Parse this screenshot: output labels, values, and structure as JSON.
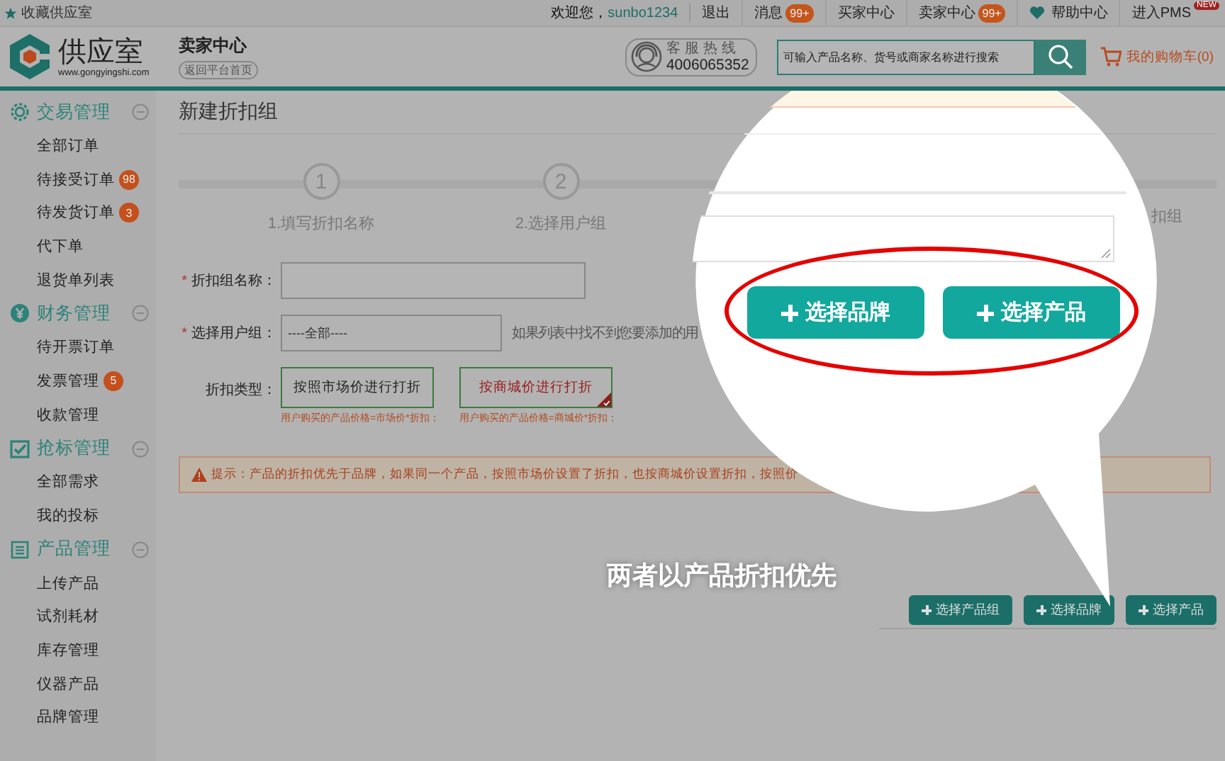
{
  "top_bar": {
    "bookmark": "收藏供应室",
    "greeting": "欢迎您，",
    "username": "sunbo1234",
    "links": [
      {
        "kind": "plain",
        "label": "退出"
      },
      {
        "kind": "badge",
        "label": "消息",
        "badge": "99+"
      },
      {
        "kind": "plain",
        "label": "买家中心"
      },
      {
        "kind": "badge",
        "label": "卖家中心",
        "badge": "99+"
      },
      {
        "kind": "help",
        "label": "帮助中心"
      },
      {
        "kind": "new",
        "label": "进入PMS",
        "tag": "NEW"
      }
    ]
  },
  "header": {
    "logo_name": "供应室",
    "logo_url": "www.gongyingshi.com",
    "title": "卖家中心",
    "back_link": "返回平台首页",
    "hotline_label": "客服热线",
    "hotline_number": "4006065352",
    "search_placeholder": "可输入产品名称、货号或商家名称进行搜索",
    "cart": "我的购物车(0)"
  },
  "sidebar": {
    "groups": [
      {
        "kind": "trade",
        "title": "交易管理",
        "expanded": true,
        "items": [
          {
            "label": "全部订单"
          },
          {
            "label": "待接受订单",
            "badge": "98"
          },
          {
            "label": "待发货订单",
            "badge": "3"
          },
          {
            "label": "代下单"
          },
          {
            "label": "退货单列表"
          }
        ]
      },
      {
        "kind": "finance",
        "title": "财务管理",
        "expanded": true,
        "items": [
          {
            "label": "待开票订单"
          },
          {
            "label": "发票管理",
            "badge": "5"
          },
          {
            "label": "收款管理"
          }
        ]
      },
      {
        "kind": "bid",
        "title": "抢标管理",
        "expanded": true,
        "items": [
          {
            "label": "全部需求"
          },
          {
            "label": "我的投标"
          }
        ]
      },
      {
        "kind": "product",
        "title": "产品管理",
        "expanded": true,
        "items": [
          {
            "label": "上传产品"
          },
          {
            "label": "试剂耗材"
          },
          {
            "label": "库存管理"
          },
          {
            "label": "仪器产品"
          },
          {
            "label": "品牌管理"
          }
        ]
      }
    ]
  },
  "main": {
    "title": "新建折扣组",
    "steps": [
      {
        "number": "1",
        "label": "1.填写折扣名称"
      },
      {
        "number": "2",
        "label": "2.选择用户组"
      }
    ],
    "step_partial_label": "扣组",
    "form": {
      "name_label": "折扣组名称：",
      "name_marker": "*",
      "group_label": "选择用户组：",
      "group_marker": "*",
      "group_value": "----全部----",
      "group_hint": "如果列表中找不到您要添加的用",
      "type_label": "折扣类型：",
      "type_options": [
        {
          "label": "按照市场价进行打折",
          "note": "用户购买的产品价格=市场价*折扣；",
          "selected": false
        },
        {
          "label": "按商城价进行打折",
          "note": "用户购买的产品价格=商城价*折扣；",
          "selected": true
        }
      ]
    },
    "notice": "提示：产品的折扣优先于品牌，如果同一个产品，按照市场价设置了折扣，也按商城价设置折扣，按照价",
    "actions": [
      {
        "label": "选择产品组"
      },
      {
        "label": "选择品牌"
      },
      {
        "label": "选择产品"
      }
    ]
  },
  "callout": {
    "buttons": [
      {
        "label": "选择品牌"
      },
      {
        "label": "选择产品"
      }
    ],
    "caption": "两者以产品折扣优先"
  }
}
